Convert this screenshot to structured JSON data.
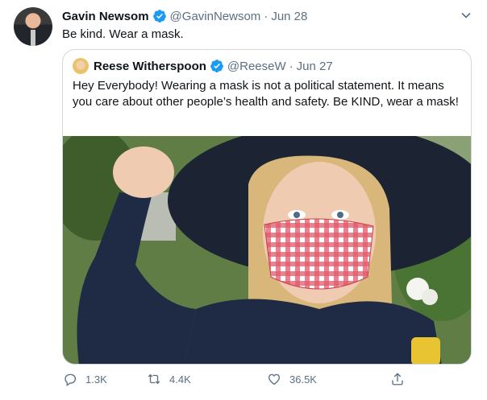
{
  "tweet": {
    "author": {
      "name": "Gavin Newsom",
      "handle": "@GavinNewsom",
      "separator": "·",
      "date": "Jun 28"
    },
    "text": "Be kind. Wear a mask.",
    "quoted": {
      "author": {
        "name": "Reese Witherspoon",
        "handle": "@ReeseW",
        "separator": "·",
        "date": "Jun 27"
      },
      "text": "Hey Everybody! Wearing a mask is not a political statement. It means you care about other people’s health and safety. Be KIND, wear a mask!"
    },
    "actions": {
      "replies": "1.3K",
      "retweets": "4.4K",
      "likes": "36.5K"
    }
  },
  "colors": {
    "verified": "#1d9bf0",
    "secondary_text": "#5b7083",
    "border": "#cfd9de"
  },
  "icons": [
    "chevron-down-icon",
    "verified-badge-icon",
    "reply-icon",
    "retweet-icon",
    "like-icon",
    "share-icon"
  ]
}
